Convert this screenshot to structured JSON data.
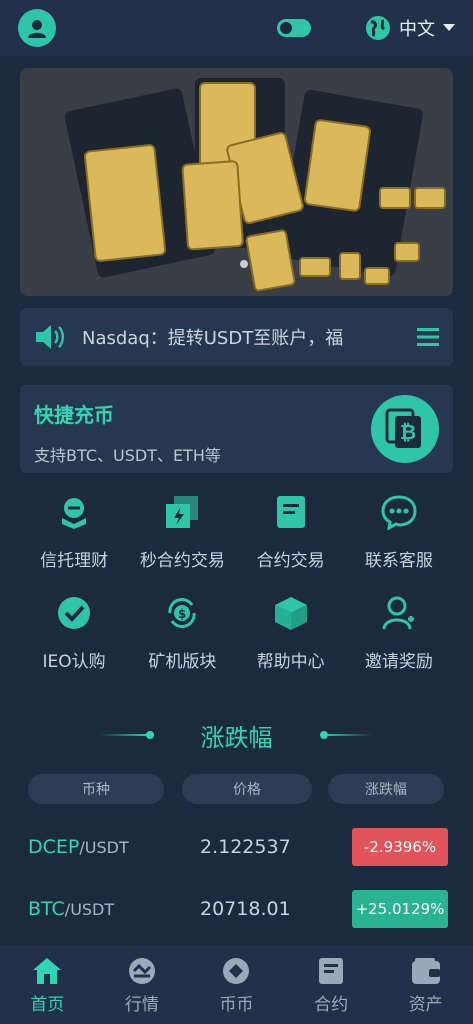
{
  "header": {
    "language": "中文"
  },
  "notice": {
    "text": "Nasdaq：提转USDT至账户，福"
  },
  "quick_deposit": {
    "title": "快捷充币",
    "subtitle": "支持BTC、USDT、ETH等"
  },
  "grid": {
    "items": [
      {
        "label": "信托理财",
        "icon": "trust-finance-icon"
      },
      {
        "label": "秒合约交易",
        "icon": "second-contract-icon"
      },
      {
        "label": "合约交易",
        "icon": "contract-icon"
      },
      {
        "label": "联系客服",
        "icon": "customer-service-icon"
      },
      {
        "label": "IEO认购",
        "icon": "ieo-icon"
      },
      {
        "label": "矿机版块",
        "icon": "mining-icon"
      },
      {
        "label": "帮助中心",
        "icon": "help-center-icon"
      },
      {
        "label": "邀请奖励",
        "icon": "invite-icon"
      }
    ]
  },
  "market": {
    "title": "涨跌幅",
    "columns": [
      "币种",
      "价格",
      "涨跌幅"
    ],
    "rows": [
      {
        "base": "DCEP",
        "quote": "/USDT",
        "price": "2.122537",
        "change": "-2.9396%",
        "direction": "down"
      },
      {
        "base": "BTC",
        "quote": "/USDT",
        "price": "20718.01",
        "change": "+25.0129%",
        "direction": "up"
      }
    ]
  },
  "bottom_nav": {
    "items": [
      {
        "label": "首页",
        "active": true
      },
      {
        "label": "行情",
        "active": false
      },
      {
        "label": "币币",
        "active": false
      },
      {
        "label": "合约",
        "active": false
      },
      {
        "label": "资产",
        "active": false
      }
    ]
  },
  "colors": {
    "accent": "#2fd6b4",
    "background": "#1c2a3f",
    "negative": "#e0545a",
    "positive": "#28b491"
  }
}
